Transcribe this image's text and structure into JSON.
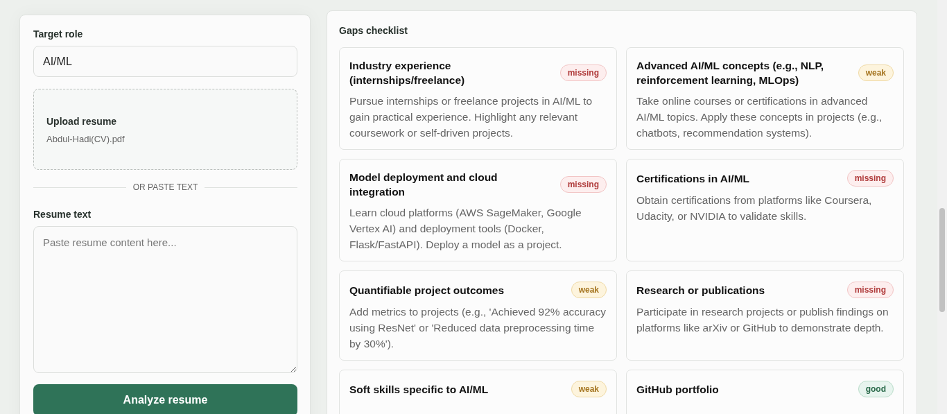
{
  "form": {
    "target_role": {
      "label": "Target role",
      "value": "AI/ML"
    },
    "upload": {
      "title": "Upload resume",
      "file_name": "Abdul-Hadi(CV).pdf"
    },
    "divider": "OR PASTE TEXT",
    "resume_text": {
      "label": "Resume text",
      "placeholder": "Paste resume content here..."
    },
    "submit": "Analyze resume"
  },
  "gaps": {
    "title": "Gaps checklist",
    "items": [
      {
        "title": "Industry experience (internships/freelance)",
        "status": "missing",
        "description": "Pursue internships or freelance projects in AI/ML to gain practical experience. Highlight any relevant coursework or self-driven projects."
      },
      {
        "title": "Advanced AI/ML concepts (e.g., NLP, reinforcement learning, MLOps)",
        "status": "weak",
        "description": "Take online courses or certifications in advanced AI/ML topics. Apply these concepts in projects (e.g., chatbots, recommendation systems)."
      },
      {
        "title": "Model deployment and cloud integration",
        "status": "missing",
        "description": "Learn cloud platforms (AWS SageMaker, Google Vertex AI) and deployment tools (Docker, Flask/FastAPI). Deploy a model as a project."
      },
      {
        "title": "Certifications in AI/ML",
        "status": "missing",
        "description": "Obtain certifications from platforms like Coursera, Udacity, or NVIDIA to validate skills."
      },
      {
        "title": "Quantifiable project outcomes",
        "status": "weak",
        "description": "Add metrics to projects (e.g., 'Achieved 92% accuracy using ResNet' or 'Reduced data preprocessing time by 30%')."
      },
      {
        "title": "Research or publications",
        "status": "missing",
        "description": "Participate in research projects or publish findings on platforms like arXiv or GitHub to demonstrate depth."
      },
      {
        "title": "Soft skills specific to AI/ML",
        "status": "weak"
      },
      {
        "title": "GitHub portfolio",
        "status": "good"
      }
    ]
  }
}
